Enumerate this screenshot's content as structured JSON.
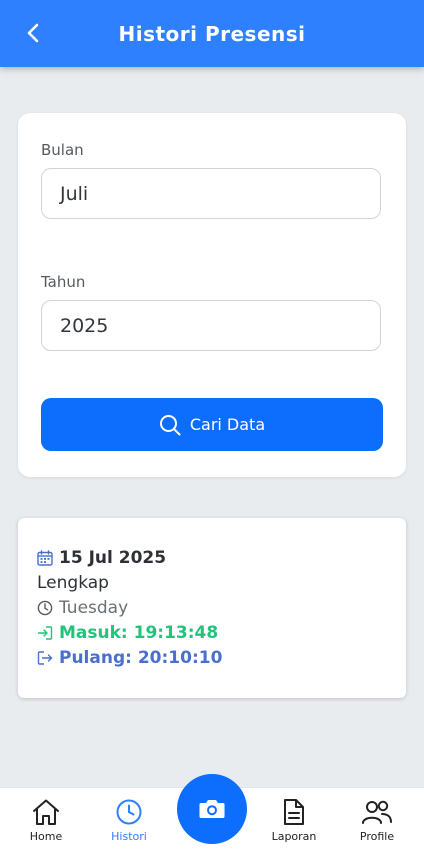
{
  "header": {
    "title": "Histori Presensi"
  },
  "form": {
    "month_label": "Bulan",
    "month_value": "Juli",
    "year_label": "Tahun",
    "year_value": "2025",
    "search_label": "Cari Data"
  },
  "records": [
    {
      "date": "15 Jul 2025",
      "status": "Lengkap",
      "day": "Tuesday",
      "check_in": "Masuk: 19:13:48",
      "check_out": "Pulang: 20:10:10"
    }
  ],
  "nav": {
    "items": [
      {
        "label": "Home",
        "icon": "home-icon"
      },
      {
        "label": "Histori",
        "icon": "clock-icon"
      },
      {
        "label": "Laporan",
        "icon": "document-icon"
      },
      {
        "label": "Profile",
        "icon": "users-icon"
      }
    ],
    "active": "Histori",
    "fab_icon": "camera-icon"
  },
  "colors": {
    "primary": "#2f80ff",
    "button": "#0d6efd",
    "check_in": "#20c47a",
    "check_out": "#4a6fcf",
    "background": "#e9ecef"
  }
}
